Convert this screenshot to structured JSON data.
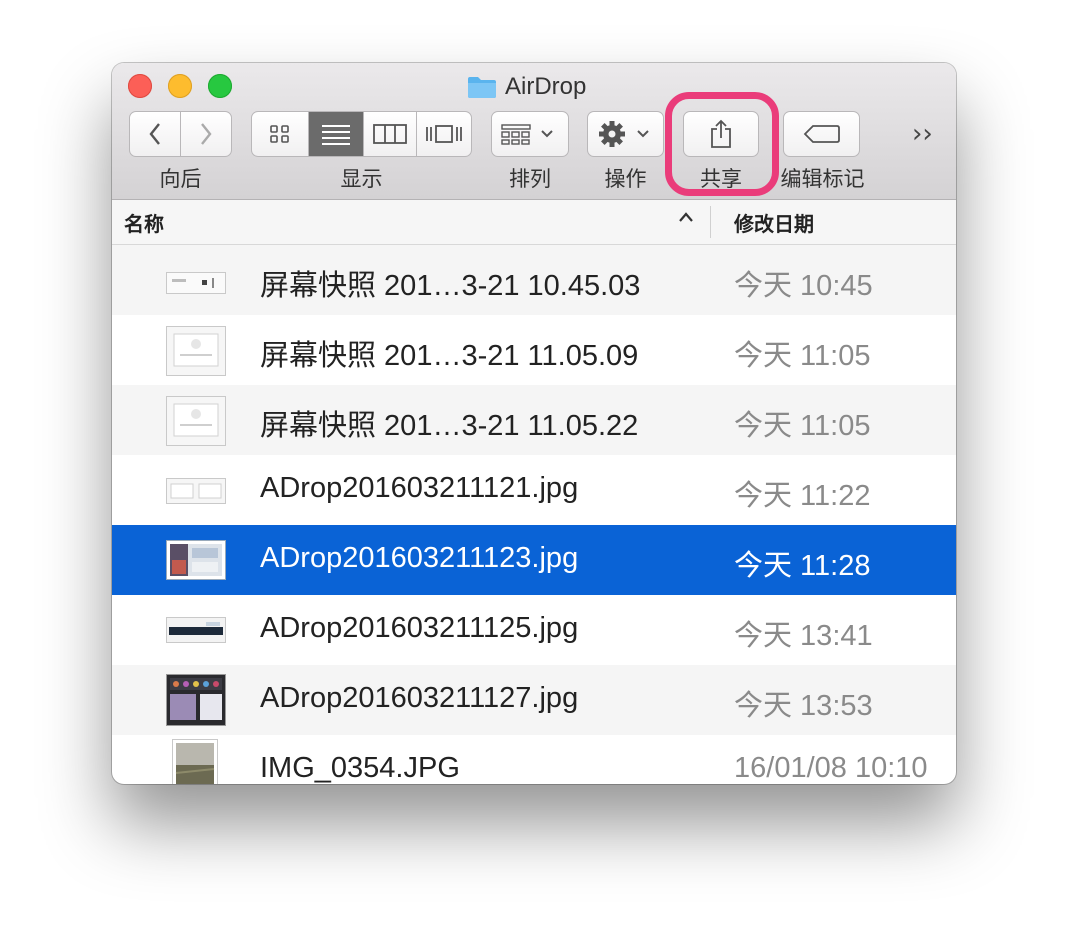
{
  "window": {
    "title": "AirDrop",
    "title_icon": "folder-icon"
  },
  "toolbar": {
    "back_label": "向后",
    "view_label": "显示",
    "arrange_label": "排列",
    "action_label": "操作",
    "share_label": "共享",
    "tags_label": "编辑标记",
    "overflow": "››"
  },
  "columns": {
    "name": "名称",
    "date": "修改日期"
  },
  "files": [
    {
      "name": "屏幕快照 201…3-21 10.45.03",
      "date": "今天 10:45"
    },
    {
      "name": "屏幕快照 201…3-21 11.05.09",
      "date": "今天 11:05"
    },
    {
      "name": "屏幕快照 201…3-21 11.05.22",
      "date": "今天 11:05"
    },
    {
      "name": "ADrop201603211121.jpg",
      "date": "今天 11:22"
    },
    {
      "name": "ADrop201603211123.jpg",
      "date": "今天 11:28"
    },
    {
      "name": "ADrop201603211125.jpg",
      "date": "今天 13:41"
    },
    {
      "name": "ADrop201603211127.jpg",
      "date": "今天 13:53"
    },
    {
      "name": "IMG_0354.JPG",
      "date": "16/01/08 10:10"
    }
  ],
  "selected_file_index": 4,
  "colors": {
    "selection": "#0a63d6",
    "highlight_ring": "#ea3c7a"
  }
}
